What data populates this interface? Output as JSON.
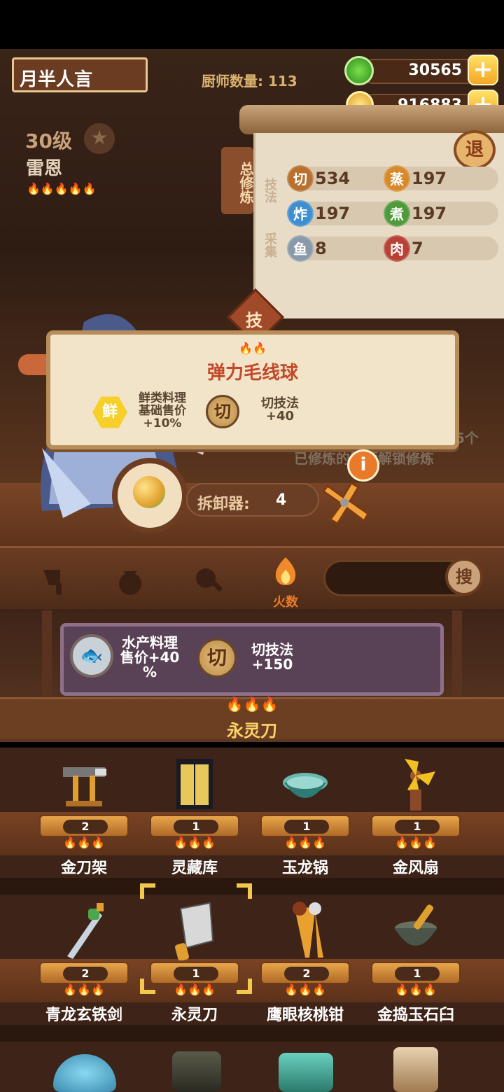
{
  "header": {
    "player_name": "月半人言",
    "chef_count": "厨师数量: 113",
    "jade": "30565",
    "coins": "916883",
    "plus": "+"
  },
  "chef": {
    "level": "30级",
    "star": "★",
    "name": "雷恩",
    "flames": "🔥🔥🔥🔥🔥"
  },
  "cultivation": {
    "label": "总修炼",
    "tech_label": "技法",
    "gather_label": "采集",
    "exit": "退",
    "tech_tab": "技",
    "stats": [
      {
        "icon": "切",
        "value": "534",
        "color": "#b8702e"
      },
      {
        "icon": "蒸",
        "value": "197",
        "color": "#d88a2a"
      },
      {
        "icon": "炸",
        "value": "197",
        "color": "#3f8fd0"
      },
      {
        "icon": "煮",
        "value": "197",
        "color": "#4f9a3a"
      },
      {
        "icon": "鱼",
        "value": "8",
        "color": "#8a9aa8"
      },
      {
        "icon": "肉",
        "value": "7",
        "color": "#b84034"
      }
    ]
  },
  "tooltip": {
    "flames": "🔥🔥",
    "title": "弹力毛线球",
    "effect1_icon": "鲜",
    "effect1_text": "鲜类料理\n基础售价\n+10%",
    "effect2_icon": "切",
    "effect2_text": "切技法\n+40"
  },
  "behind": {
    "line1": "有5个",
    "line2": "已修炼的厨师解锁修炼"
  },
  "disassembler": {
    "label": "拆卸器:",
    "count": "4",
    "info": "i"
  },
  "filter": {
    "fire_label": "火数",
    "search": "搜"
  },
  "selected": {
    "effect1": "水产料理\n售价+40\n%",
    "effect2_icon": "切",
    "effect2": "切技法\n+150",
    "flames": "🔥🔥🔥",
    "name": "永灵刀"
  },
  "items": [
    {
      "name": "金刀架",
      "count": "2",
      "flames": "🔥🔥🔥",
      "art": "rack"
    },
    {
      "name": "灵藏库",
      "count": "1",
      "flames": "🔥🔥🔥",
      "art": "cabinet"
    },
    {
      "name": "玉龙锅",
      "count": "1",
      "flames": "🔥🔥🔥",
      "art": "pot"
    },
    {
      "name": "金风扇",
      "count": "1",
      "flames": "🔥🔥🔥",
      "art": "fan"
    },
    {
      "name": "青龙玄铁剑",
      "count": "2",
      "flames": "🔥🔥🔥",
      "art": "sword"
    },
    {
      "name": "永灵刀",
      "count": "1",
      "flames": "🔥🔥🔥",
      "art": "cleaver"
    },
    {
      "name": "鹰眼核桃钳",
      "count": "2",
      "flames": "🔥🔥🔥",
      "art": "nutcracker"
    },
    {
      "name": "金捣玉石臼",
      "count": "1",
      "flames": "🔥🔥🔥",
      "art": "mortar"
    }
  ]
}
